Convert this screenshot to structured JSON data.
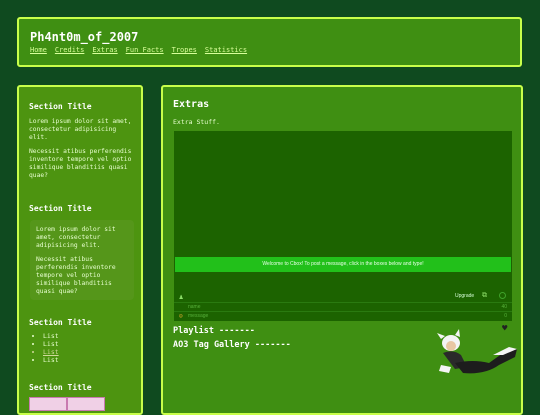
{
  "header": {
    "title": "Ph4nt0m_of_2007",
    "nav": [
      "Home",
      "Credits",
      "Extras",
      "Fun Facts",
      "Tropes",
      "Statistics"
    ]
  },
  "sidebar": {
    "sections": [
      {
        "title": "Section Title",
        "paragraphs": [
          "Lorem ipsum dolor sit amet, consectetur adipisicing elit.",
          "Necessit atibus perferendis inventore tempore vel optio similique blanditiis quasi quae?"
        ]
      },
      {
        "title": "Section Title",
        "box_paragraphs": [
          "Lorem ipsum dolor sit amet, consectetur adipisicing elit.",
          "Necessit atibus perferendis inventore tempore vel optio similique blanditiis quasi quae?"
        ]
      },
      {
        "title": "Section Title",
        "list": [
          "List",
          "List",
          "List",
          "List"
        ]
      },
      {
        "title": "Section Title"
      }
    ]
  },
  "main": {
    "heading": "Extras",
    "subtext": "Extra Stuff.",
    "chat": {
      "welcome": "Welcome to Cbox! To post a message, click in the boxes below and type!",
      "upgrade": "Upgrade",
      "name_field": "name",
      "message_field": "message",
      "name_count": "40",
      "message_count": "0"
    },
    "playlist": "Playlist -------",
    "ao3": "AO3 Tag Gallery -------"
  }
}
